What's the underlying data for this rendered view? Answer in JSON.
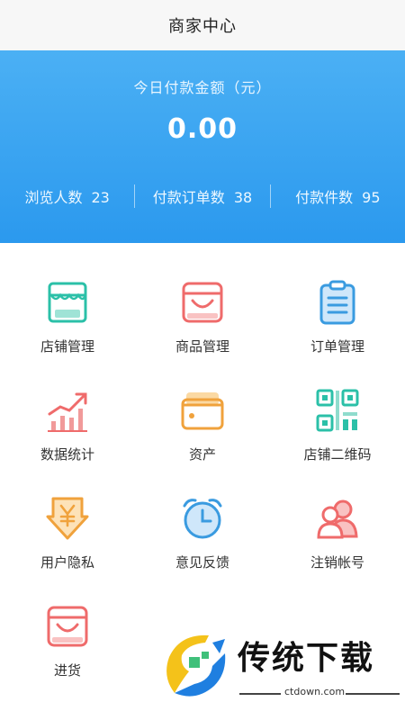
{
  "header": {
    "title": "商家中心"
  },
  "summary": {
    "label": "今日付款金额（元）",
    "amount": "0.00",
    "stats": [
      {
        "label": "浏览人数",
        "value": "23"
      },
      {
        "label": "付款订单数",
        "value": "38"
      },
      {
        "label": "付款件数",
        "value": "95"
      }
    ]
  },
  "menu": [
    {
      "label": "店铺管理",
      "icon": "store-icon"
    },
    {
      "label": "商品管理",
      "icon": "shopping-bag-icon"
    },
    {
      "label": "订单管理",
      "icon": "clipboard-icon"
    },
    {
      "label": "数据统计",
      "icon": "bar-chart-icon"
    },
    {
      "label": "资产",
      "icon": "wallet-icon"
    },
    {
      "label": "店铺二维码",
      "icon": "qr-code-icon"
    },
    {
      "label": "用户隐私",
      "icon": "yuan-shield-icon"
    },
    {
      "label": "意见反馈",
      "icon": "alarm-clock-icon"
    },
    {
      "label": "注销帐号",
      "icon": "users-icon"
    },
    {
      "label": "进货",
      "icon": "shopping-bag-icon"
    }
  ],
  "watermark": {
    "brand": "传统下载",
    "url": "ctdown.com"
  },
  "colors": {
    "hero": "#2b99ee",
    "teal": "#2bc0a8",
    "coral": "#ef6b6b",
    "orange": "#f0a23c",
    "blue": "#3a9be0"
  }
}
